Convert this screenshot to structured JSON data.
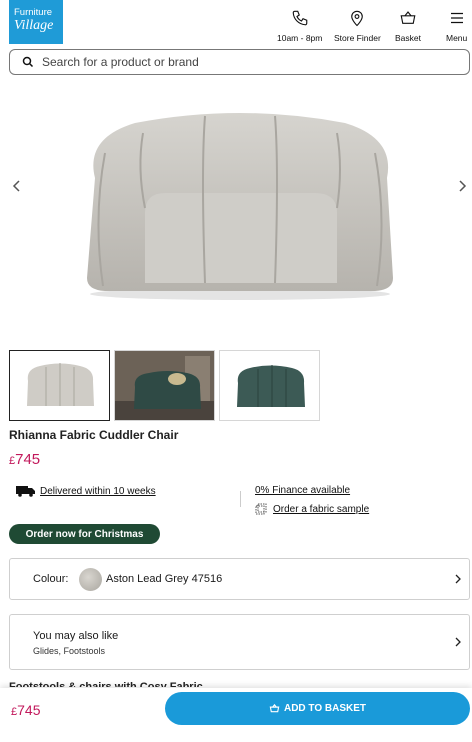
{
  "header": {
    "logo_line1": "Furniture",
    "logo_line2": "Village",
    "nav": [
      {
        "label": "10am - 8pm",
        "icon": "phone-icon"
      },
      {
        "label": "Store Finder",
        "icon": "location-pin-icon"
      },
      {
        "label": "Basket",
        "icon": "basket-icon"
      },
      {
        "label": "Menu",
        "icon": "hamburger-menu-icon"
      }
    ]
  },
  "search": {
    "placeholder": "Search for a product or brand"
  },
  "product": {
    "title": "Rhianna Fabric Cuddler Chair",
    "currency": "£",
    "price": "745",
    "delivery": "Delivered within 10 weeks",
    "finance": "0% Finance available",
    "sample": "Order a fabric sample",
    "promo": "Order now for Christmas",
    "colour_label": "Colour:",
    "colour_value": "Aston Lead Grey 47516",
    "also_heading": "You may also like",
    "also_sub": "Glides, Footstools",
    "next_section_peek": "Footstools & chairs with Cosy Fabric"
  },
  "sticky": {
    "currency": "£",
    "price": "745",
    "add_label": "ADD TO BASKET"
  },
  "colors": {
    "brand_blue": "#1f9bd7",
    "price_pink": "#c2185b",
    "promo_green": "#1f4a34",
    "button_blue": "#1a9ad9"
  }
}
